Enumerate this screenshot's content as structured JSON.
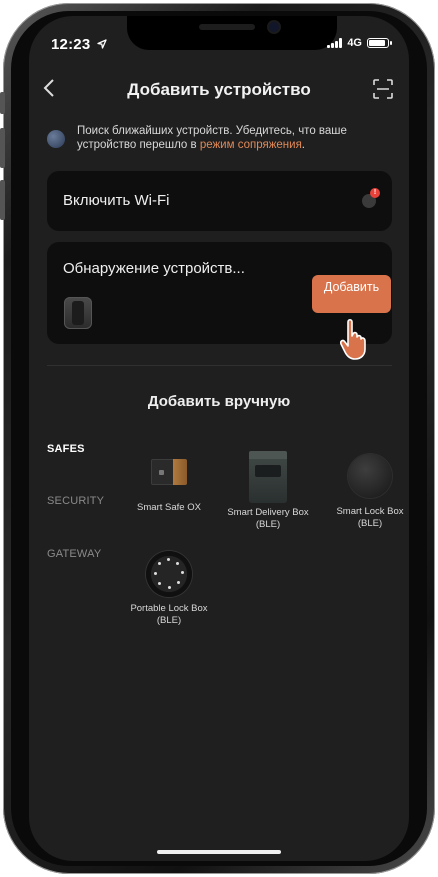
{
  "status_bar": {
    "time": "12:23",
    "network": "4G"
  },
  "nav": {
    "title": "Добавить устройство"
  },
  "hint": {
    "text": "Поиск ближайших устройств. Убедитесь, что ваше устройство перешло в ",
    "link": "режим сопряжения",
    "suffix": "."
  },
  "wifi": {
    "label": "Включить Wi‑Fi",
    "badge": "!"
  },
  "detect": {
    "title": "Обнаружение устройств...",
    "add_label": "Добавить"
  },
  "manual": {
    "title": "Добавить вручную"
  },
  "categories": [
    {
      "label": "SAFES",
      "active": true
    },
    {
      "label": "SECURITY",
      "active": false
    },
    {
      "label": "GATEWAY",
      "active": false
    }
  ],
  "devices": [
    {
      "name": "Smart Safe OX",
      "icon": "safe-icon"
    },
    {
      "name": "Smart Delivery Box (BLE)",
      "icon": "delivery-box-icon"
    },
    {
      "name": "Smart Lock Box (BLE)",
      "icon": "lock-box-icon"
    },
    {
      "name": "Portable Lock Box (BLE)",
      "icon": "portable-lock-box-icon"
    }
  ],
  "colors": {
    "accent": "#d9734b",
    "link": "#e08a58",
    "card": "#0e0e0e",
    "screen": "#1f1f1f"
  }
}
